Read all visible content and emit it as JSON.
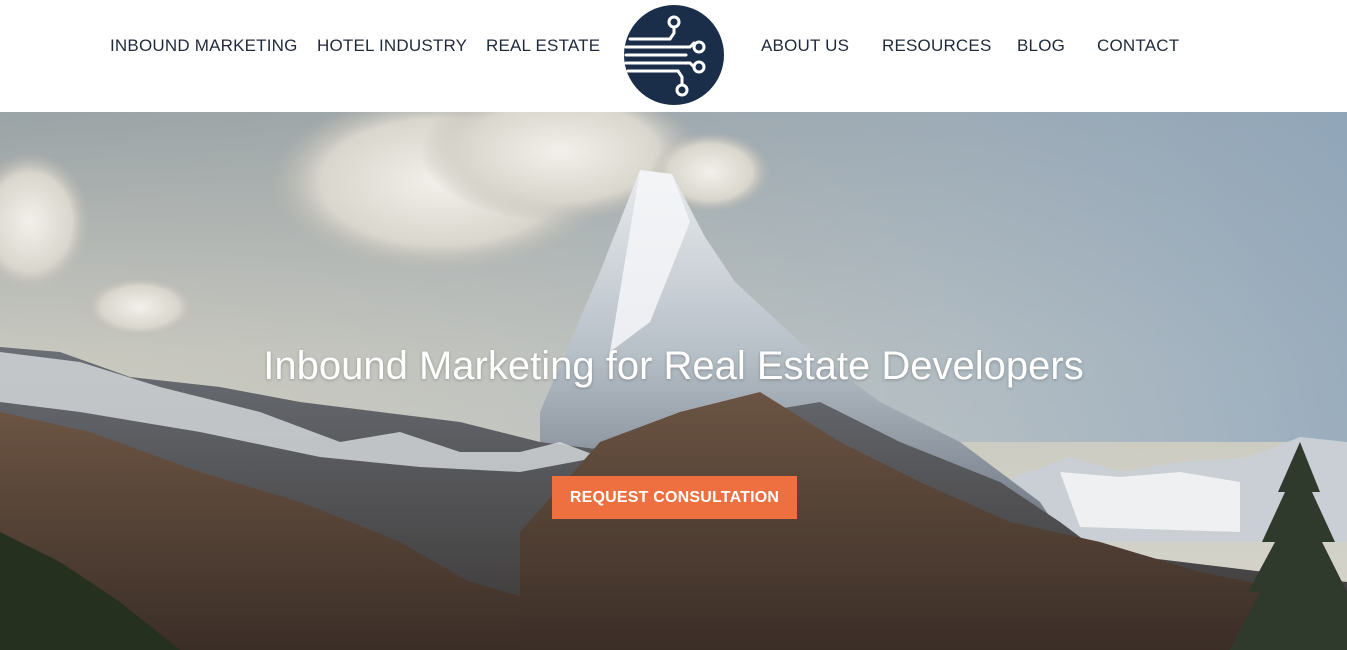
{
  "nav": {
    "left": [
      {
        "label": "INBOUND MARKETING"
      },
      {
        "label": "HOTEL INDUSTRY"
      },
      {
        "label": "REAL ESTATE"
      }
    ],
    "right": [
      {
        "label": "ABOUT US"
      },
      {
        "label": "RESOURCES"
      },
      {
        "label": "BLOG"
      },
      {
        "label": "CONTACT"
      }
    ]
  },
  "logo": {
    "icon": "circuit-logo-icon",
    "color": "#1a2e4a"
  },
  "hero": {
    "title": "Inbound Marketing for Real Estate Developers",
    "cta_label": "REQUEST CONSULTATION",
    "cta_color": "#ee6f3f",
    "background": "mountain-landscape-image"
  }
}
